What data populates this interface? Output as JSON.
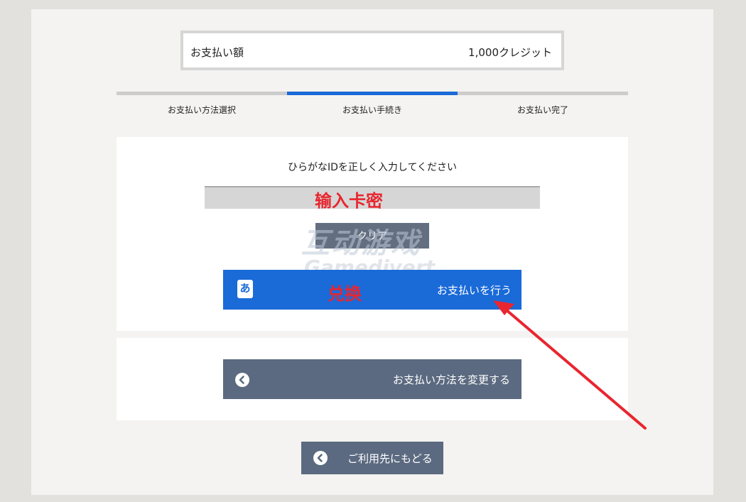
{
  "payment": {
    "amount_label": "お支払い額",
    "amount_value": "1,000クレジット"
  },
  "steps": [
    {
      "label": "お支払い方法選択",
      "active": false
    },
    {
      "label": "お支払い手続き",
      "active": true
    },
    {
      "label": "お支払い完了",
      "active": false
    }
  ],
  "form": {
    "prompt": "ひらがなIDを正しく入力してください",
    "id_value": "",
    "clear_label": "クリア",
    "pay_icon_char": "あ",
    "pay_label": "お支払いを行う"
  },
  "change_method": {
    "label": "お支払い方法を変更する"
  },
  "back": {
    "label": "ご利用先にもどる"
  },
  "annotations": {
    "input_overlay": "输入卡密",
    "button_overlay": "兑换",
    "watermark_top": "互动游戏",
    "watermark_bottom": "Gamedivert"
  },
  "colors": {
    "accent": "#1a6ad8",
    "secondary_button": "#5b6a80",
    "annotation_red": "#e8262f"
  },
  "icons": {
    "pay_icon": "hiragana-a-icon",
    "change_icon": "chevron-left-circle-icon",
    "back_icon": "chevron-left-circle-icon"
  }
}
